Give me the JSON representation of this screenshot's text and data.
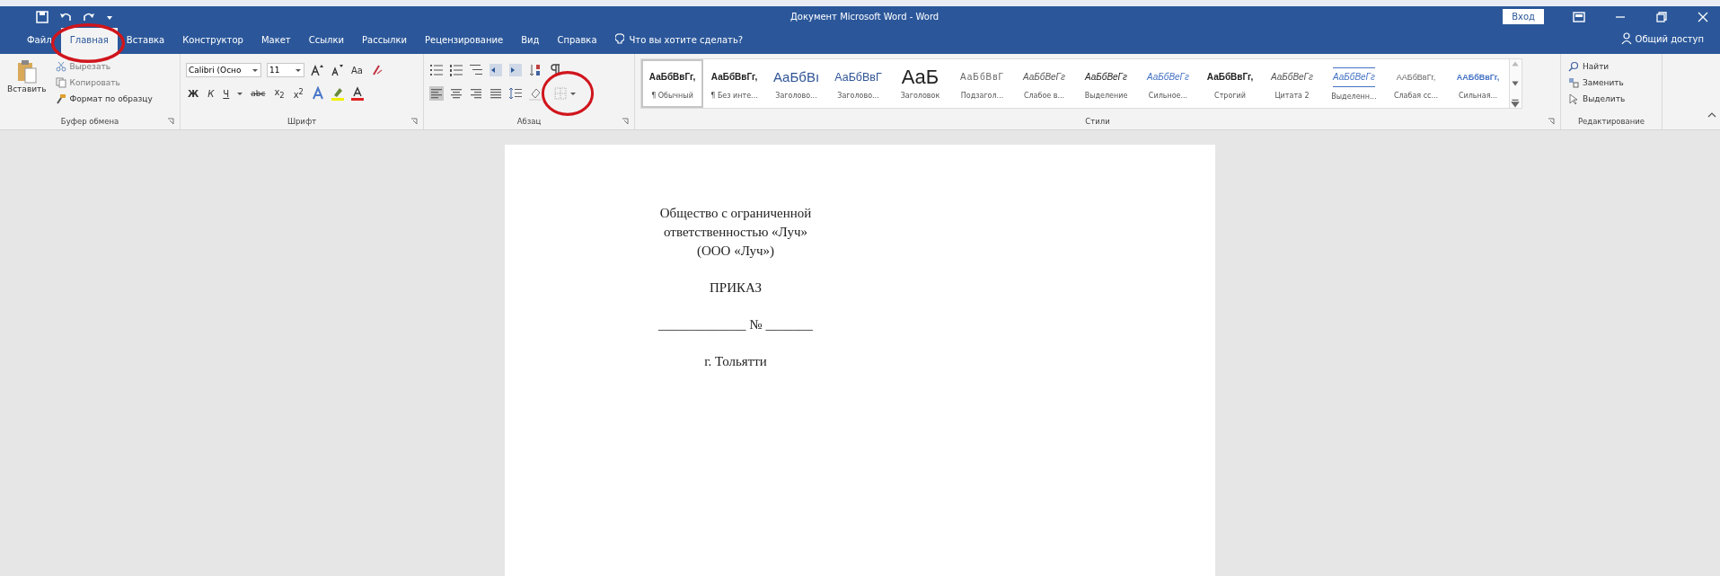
{
  "window": {
    "title": "Документ Microsoft Word  -  Word",
    "sign_in": "Вход",
    "share": "Общий доступ"
  },
  "tabs": [
    {
      "label": "Файл",
      "selected": false
    },
    {
      "label": "Главная",
      "selected": true
    },
    {
      "label": "Вставка",
      "selected": false
    },
    {
      "label": "Конструктор",
      "selected": false
    },
    {
      "label": "Макет",
      "selected": false
    },
    {
      "label": "Ссылки",
      "selected": false
    },
    {
      "label": "Рассылки",
      "selected": false
    },
    {
      "label": "Рецензирование",
      "selected": false
    },
    {
      "label": "Вид",
      "selected": false
    },
    {
      "label": "Справка",
      "selected": false
    }
  ],
  "tell_me": {
    "placeholder": "Что вы хотите сделать?"
  },
  "clipboard": {
    "paste": "Вставить",
    "cut": {
      "label": "Вырезать",
      "disabled": true
    },
    "copy": {
      "label": "Копировать",
      "disabled": true
    },
    "format_painter": {
      "label": "Формат по образцу",
      "disabled": false
    },
    "group_label": "Буфер обмена"
  },
  "font": {
    "font_name": "Calibri (Осно",
    "font_size": "11",
    "case_button": "Aa",
    "bold": "Ж",
    "italic": "К",
    "underline": "Ч",
    "strikethrough": "abc",
    "subscript": "x$_{2}$",
    "superscript": "x$^{2}$",
    "group_label": "Шрифт"
  },
  "paragraph": {
    "alignment": [
      {
        "kind": "left",
        "selected": true
      },
      {
        "kind": "center",
        "selected": false
      },
      {
        "kind": "right",
        "selected": false
      },
      {
        "kind": "justify",
        "selected": false
      }
    ],
    "group_label": "Абзац"
  },
  "styles": {
    "items": [
      {
        "kind": "normal",
        "sample": "АаБбВвГг,",
        "name": "¶ Обычный",
        "selected": true
      },
      {
        "kind": "normal",
        "sample": "АаБбВвГг,",
        "name": "¶ Без инте...",
        "selected": false
      },
      {
        "kind": "heading1",
        "sample": "АаБбВı",
        "name": "Заголово...",
        "selected": false
      },
      {
        "kind": "heading2",
        "sample": "АаБбВвГ",
        "name": "Заголово...",
        "selected": false
      },
      {
        "kind": "title",
        "sample": "АаБ",
        "name": "Заголовок",
        "selected": false
      },
      {
        "kind": "subtitle",
        "sample": "АаБбВвГ",
        "name": "Подзагол...",
        "selected": false
      },
      {
        "kind": "subtle",
        "sample": "АаБбВеГг",
        "name": "Слабое в...",
        "selected": false
      },
      {
        "kind": "emphasis",
        "sample": "АаБбВеГг",
        "name": "Выделение",
        "selected": false
      },
      {
        "kind": "intense",
        "sample": "АаБбВеГг",
        "name": "Сильное...",
        "selected": false
      },
      {
        "kind": "strong",
        "sample": "АаБбВвГг,",
        "name": "Строгий",
        "selected": false
      },
      {
        "kind": "quote",
        "sample": "АаБбВеГг",
        "name": "Цитата 2",
        "selected": false
      },
      {
        "kind": "intense-quote",
        "sample": "АаБбВеГг",
        "name": "Выделенн...",
        "selected": false
      },
      {
        "kind": "subtle-ref",
        "sample": "ААБбВвГг,",
        "name": "Слабая сс...",
        "selected": false
      },
      {
        "kind": "intense-ref",
        "sample": "ААБбВвГг,",
        "name": "Сильная...",
        "selected": false
      }
    ],
    "group_label": "Стили"
  },
  "editing": {
    "find": "Найти",
    "replace": "Заменить",
    "select": "Выделить",
    "group_label": "Редактирование"
  },
  "document": {
    "paragraphs": [
      [
        "Общество с ограниченной",
        "ответственностью «Луч»",
        "(ООО «Луч»)"
      ],
      [
        "ПРИКАЗ"
      ],
      [
        "_____________ № _______"
      ],
      [
        "г. Тольятти"
      ]
    ]
  }
}
